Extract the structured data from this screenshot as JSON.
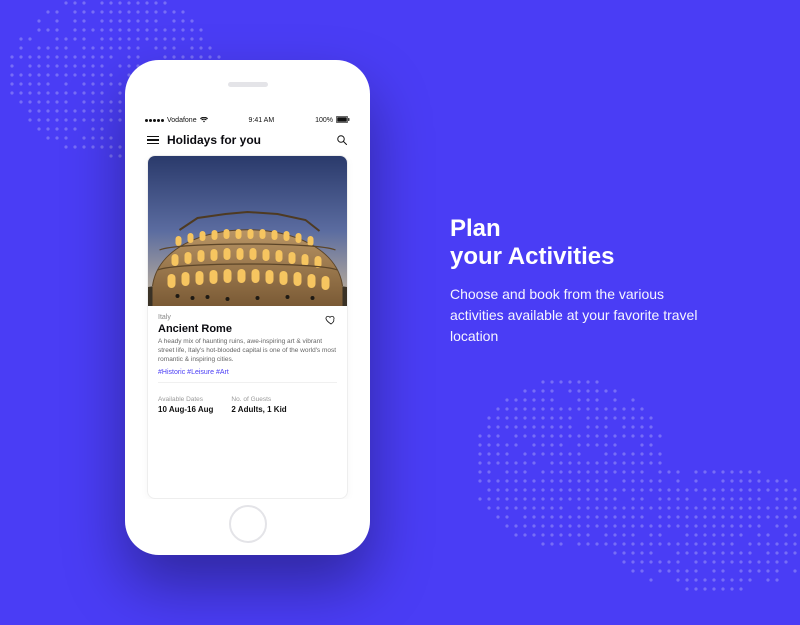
{
  "promo": {
    "heading_line1": "Plan",
    "heading_line2": "your Activities",
    "body": "Choose and book from the various activities available at your favorite travel location"
  },
  "status_bar": {
    "carrier": "Vodafone",
    "wifi": "wifi",
    "time": "9:41 AM",
    "battery_pct": "100%"
  },
  "header": {
    "title": "Holidays for you"
  },
  "card": {
    "subtitle": "Italy",
    "title": "Ancient Rome",
    "description": "A heady mix of haunting ruins, awe-inspiring art & vibrant street life, Italy's hot-blooded capital is one of the world's most romantic & inspiring cities.",
    "tags": "#Historic #Leisure #Art",
    "meta": {
      "dates_label": "Available Dates",
      "dates_value": "10 Aug-16 Aug",
      "guests_label": "No. of Guests",
      "guests_value": "2 Adults, 1 Kid"
    }
  }
}
